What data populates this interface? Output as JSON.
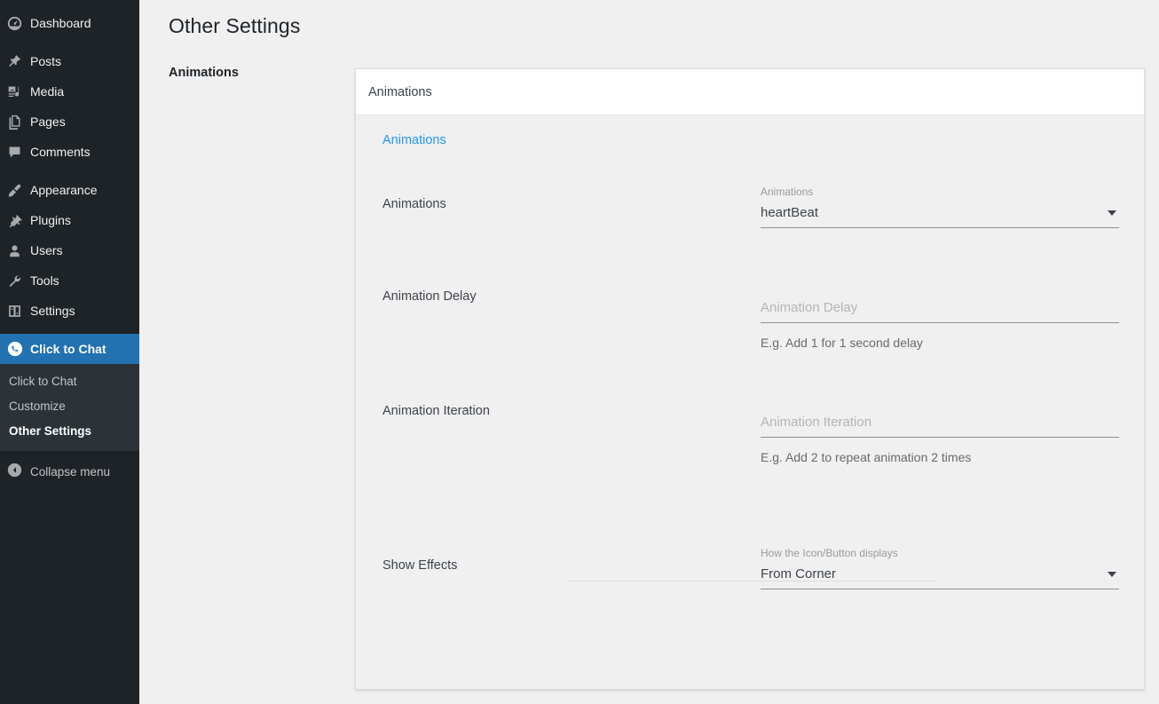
{
  "sidebar": {
    "items": [
      {
        "label": "Dashboard",
        "icon": "dashboard-icon",
        "name": "dashboard"
      },
      {
        "label": "Posts",
        "icon": "pin-icon",
        "name": "posts"
      },
      {
        "label": "Media",
        "icon": "media-icon",
        "name": "media"
      },
      {
        "label": "Pages",
        "icon": "pages-icon",
        "name": "pages"
      },
      {
        "label": "Comments",
        "icon": "comment-icon",
        "name": "comments"
      },
      {
        "label": "Appearance",
        "icon": "brush-icon",
        "name": "appearance"
      },
      {
        "label": "Plugins",
        "icon": "plug-icon",
        "name": "plugins"
      },
      {
        "label": "Users",
        "icon": "user-icon",
        "name": "users"
      },
      {
        "label": "Tools",
        "icon": "wrench-icon",
        "name": "tools"
      },
      {
        "label": "Settings",
        "icon": "sliders-icon",
        "name": "settings"
      }
    ],
    "active_item": {
      "label": "Click to Chat",
      "icon": "whatsapp-icon",
      "name": "click-to-chat"
    },
    "submenu": [
      {
        "label": "Click to Chat",
        "current": false
      },
      {
        "label": "Customize",
        "current": false
      },
      {
        "label": "Other Settings",
        "current": true
      }
    ],
    "collapse": {
      "label": "Collapse menu",
      "icon": "collapse-arrow-icon"
    },
    "colors": {
      "background": "#1d2327",
      "submenu_background": "#2c3338",
      "active": "#2271b1"
    }
  },
  "page": {
    "title": "Other Settings",
    "section_label": "Animations"
  },
  "card": {
    "header_title": "Animations",
    "anchor_link": "Animations",
    "link_color": "#2196f3",
    "rows": [
      {
        "label": "Animations",
        "type": "select",
        "caption": "Animations",
        "value": "heartBeat",
        "helper": ""
      },
      {
        "label": "Animation Delay",
        "type": "text",
        "caption": "",
        "placeholder": "Animation Delay",
        "value": "",
        "helper": "E.g. Add 1 for 1 second delay"
      },
      {
        "label": "Animation Iteration",
        "type": "text",
        "caption": "",
        "placeholder": "Animation Iteration",
        "value": "",
        "helper": "E.g. Add 2 to repeat animation 2 times"
      },
      {
        "label": "Show Effects",
        "type": "select",
        "caption": "How the Icon/Button displays",
        "value": "From Corner",
        "helper": ""
      }
    ]
  }
}
